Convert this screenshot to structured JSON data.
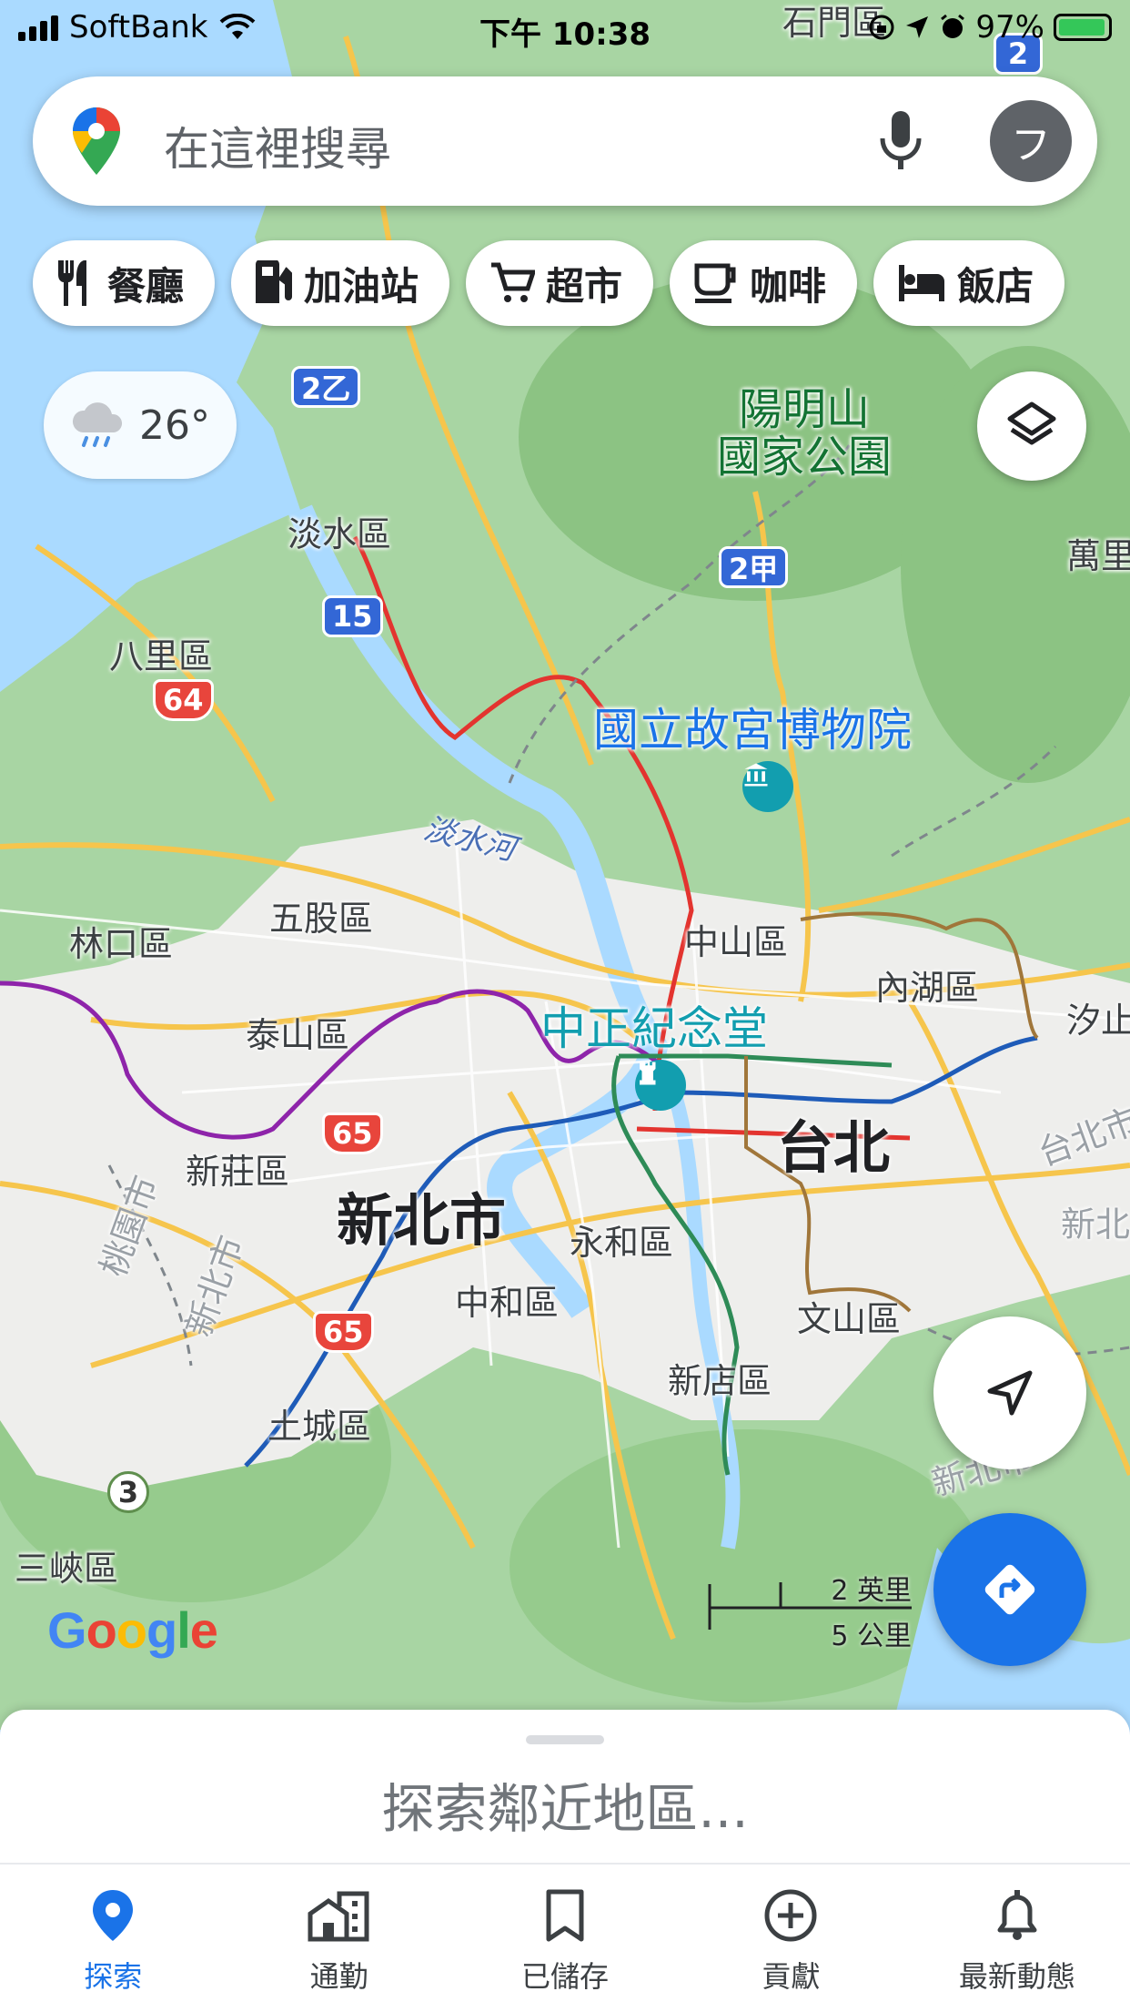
{
  "status_bar": {
    "carrier": "SoftBank",
    "time": "下午 10:38",
    "battery_percent": "97%",
    "icons": [
      "signal-icon",
      "wifi-icon",
      "orientation-lock-icon",
      "location-arrow-icon",
      "alarm-icon",
      "battery-charging-icon"
    ]
  },
  "search": {
    "placeholder": "在這裡搜尋",
    "avatar_initial": "フ",
    "icons": [
      "google-maps-pin-icon",
      "microphone-icon"
    ]
  },
  "chips": [
    {
      "label": "餐廳",
      "icon": "restaurant-icon"
    },
    {
      "label": "加油站",
      "icon": "gas-station-icon"
    },
    {
      "label": "超市",
      "icon": "shopping-cart-icon"
    },
    {
      "label": "咖啡",
      "icon": "coffee-icon"
    },
    {
      "label": "飯店",
      "icon": "hotel-bed-icon"
    }
  ],
  "weather": {
    "temperature": "26°",
    "icon": "rain-cloud-icon"
  },
  "map": {
    "labels": {
      "yangmingshan": "陽明山\n國家公園",
      "tamsui": "淡水區",
      "bali": "八里區",
      "wanli": "萬里",
      "palace_museum": "國立故宮博物院",
      "tamsui_river": "淡水河",
      "wugu": "五股區",
      "linkou": "林口區",
      "zhongshan": "中山區",
      "neihu": "內湖區",
      "xizhi": "汐止",
      "taishan": "泰山區",
      "cks_memorial": "中正紀念堂",
      "taipei": "台北",
      "xinzhuang": "新莊區",
      "new_taipei": "新北市",
      "yonghe": "永和區",
      "taoyuan_border": "桃園市",
      "new_taipei_border_1": "新北市",
      "new_taipei_border_2": "新北市",
      "taipei_border": "台北市",
      "new_taipei_border_3": "新北",
      "zhonghe": "中和區",
      "wenshan": "文山區",
      "xindian": "新店區",
      "tucheng": "土城區",
      "sanxia": "三峽區",
      "top_partial": "石門區"
    },
    "shields": {
      "r2_top": "2",
      "r2b": "2乙",
      "r2a": "2甲",
      "r15": "15",
      "r64": "64",
      "r65a": "65",
      "r65b": "65",
      "r3": "3"
    },
    "poi_icons": [
      "museum-icon",
      "landmark-icon"
    ],
    "scale": {
      "imperial": "2 英里",
      "metric": "5 公里"
    },
    "logo": "Google",
    "colors": {
      "land": "#a8d5a3",
      "urban": "#f1f1ef",
      "water": "#aadaff",
      "road": "#f6c54c",
      "mrt_red": "#e3342f",
      "mrt_blue": "#1e5bb8",
      "mrt_green": "#2e8b57",
      "mrt_brown": "#a0763a",
      "mrt_purple": "#8e24aa"
    }
  },
  "buttons": {
    "layers_icon": "layers-icon",
    "locate_icon": "navigation-arrow-icon",
    "directions_icon": "directions-icon"
  },
  "sheet": {
    "title": "探索鄰近地區..."
  },
  "tabs": [
    {
      "label": "探索",
      "icon": "explore-pin-icon",
      "active": true
    },
    {
      "label": "通勤",
      "icon": "commute-building-icon",
      "active": false
    },
    {
      "label": "已儲存",
      "icon": "bookmark-icon",
      "active": false
    },
    {
      "label": "貢獻",
      "icon": "add-circle-icon",
      "active": false
    },
    {
      "label": "最新動態",
      "icon": "bell-icon",
      "active": false
    }
  ]
}
